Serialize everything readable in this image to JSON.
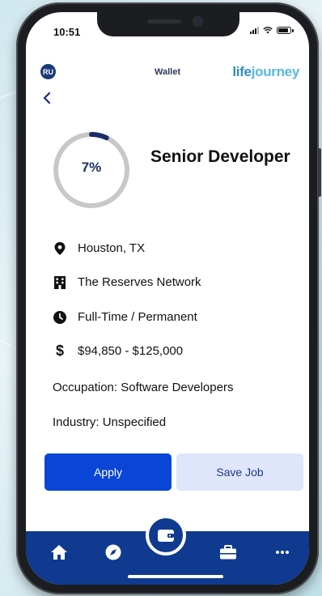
{
  "status_bar": {
    "time": "10:51"
  },
  "header": {
    "avatar_initials": "RU",
    "title": "Wallet",
    "logo_part1": "life",
    "logo_part2": "journey"
  },
  "job": {
    "match_percent_label": "7%",
    "match_fraction": 0.07,
    "title": "Senior Developer",
    "location": "Houston, TX",
    "company": "The Reserves Network",
    "employment_type": "Full-Time / Permanent",
    "salary": "$94,850 - $125,000",
    "occupation_label": "Occupation:",
    "occupation": "Software Developers",
    "industry_label": "Industry:",
    "industry": "Unspecified"
  },
  "actions": {
    "apply_label": "Apply",
    "save_label": "Save Job"
  },
  "tab_bar": {
    "items": [
      "home-icon",
      "compass-icon",
      "wallet-icon",
      "briefcase-icon",
      "more-icon"
    ],
    "active": "wallet-icon"
  },
  "colors": {
    "primary": "#0a46d6",
    "navy": "#0f3a8f",
    "secondary_button_bg": "#dfe6fb",
    "progress_track": "#c8c8c8",
    "progress_fill": "#1c2c6a"
  }
}
